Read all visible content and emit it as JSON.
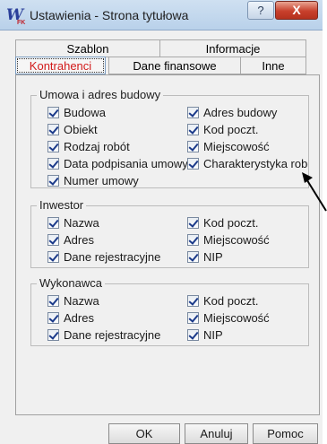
{
  "window": {
    "title": "Ustawienia - Strona tytułowa",
    "app_icon_letter": "W",
    "app_icon_sub": "FK",
    "help_label": "?",
    "close_label": "X"
  },
  "tabs_row1": [
    "Szablon",
    "Informacje"
  ],
  "tabs_row2": [
    "Kontrahenci",
    "Dane finansowe",
    "Inne"
  ],
  "active_tab": "Kontrahenci",
  "groups": {
    "umowa": {
      "legend": "Umowa i adres budowy",
      "left": [
        "Budowa",
        "Obiekt",
        "Rodzaj robót",
        "Data podpisania umowy",
        "Numer umowy"
      ],
      "right": [
        "Adres budowy",
        "Kod poczt.",
        "Miejscowość",
        "Charakterystyka robót"
      ]
    },
    "inwestor": {
      "legend": "Inwestor",
      "left": [
        "Nazwa",
        "Adres",
        "Dane rejestracyjne"
      ],
      "right": [
        "Kod poczt.",
        "Miejscowość",
        "NIP"
      ]
    },
    "wykonawca": {
      "legend": "Wykonawca",
      "left": [
        "Nazwa",
        "Adres",
        "Dane rejestracyjne"
      ],
      "right": [
        "Kod poczt.",
        "Miejscowość",
        "NIP"
      ]
    }
  },
  "buttons": {
    "ok": "OK",
    "cancel": "Anuluj",
    "help": "Pomoc"
  }
}
